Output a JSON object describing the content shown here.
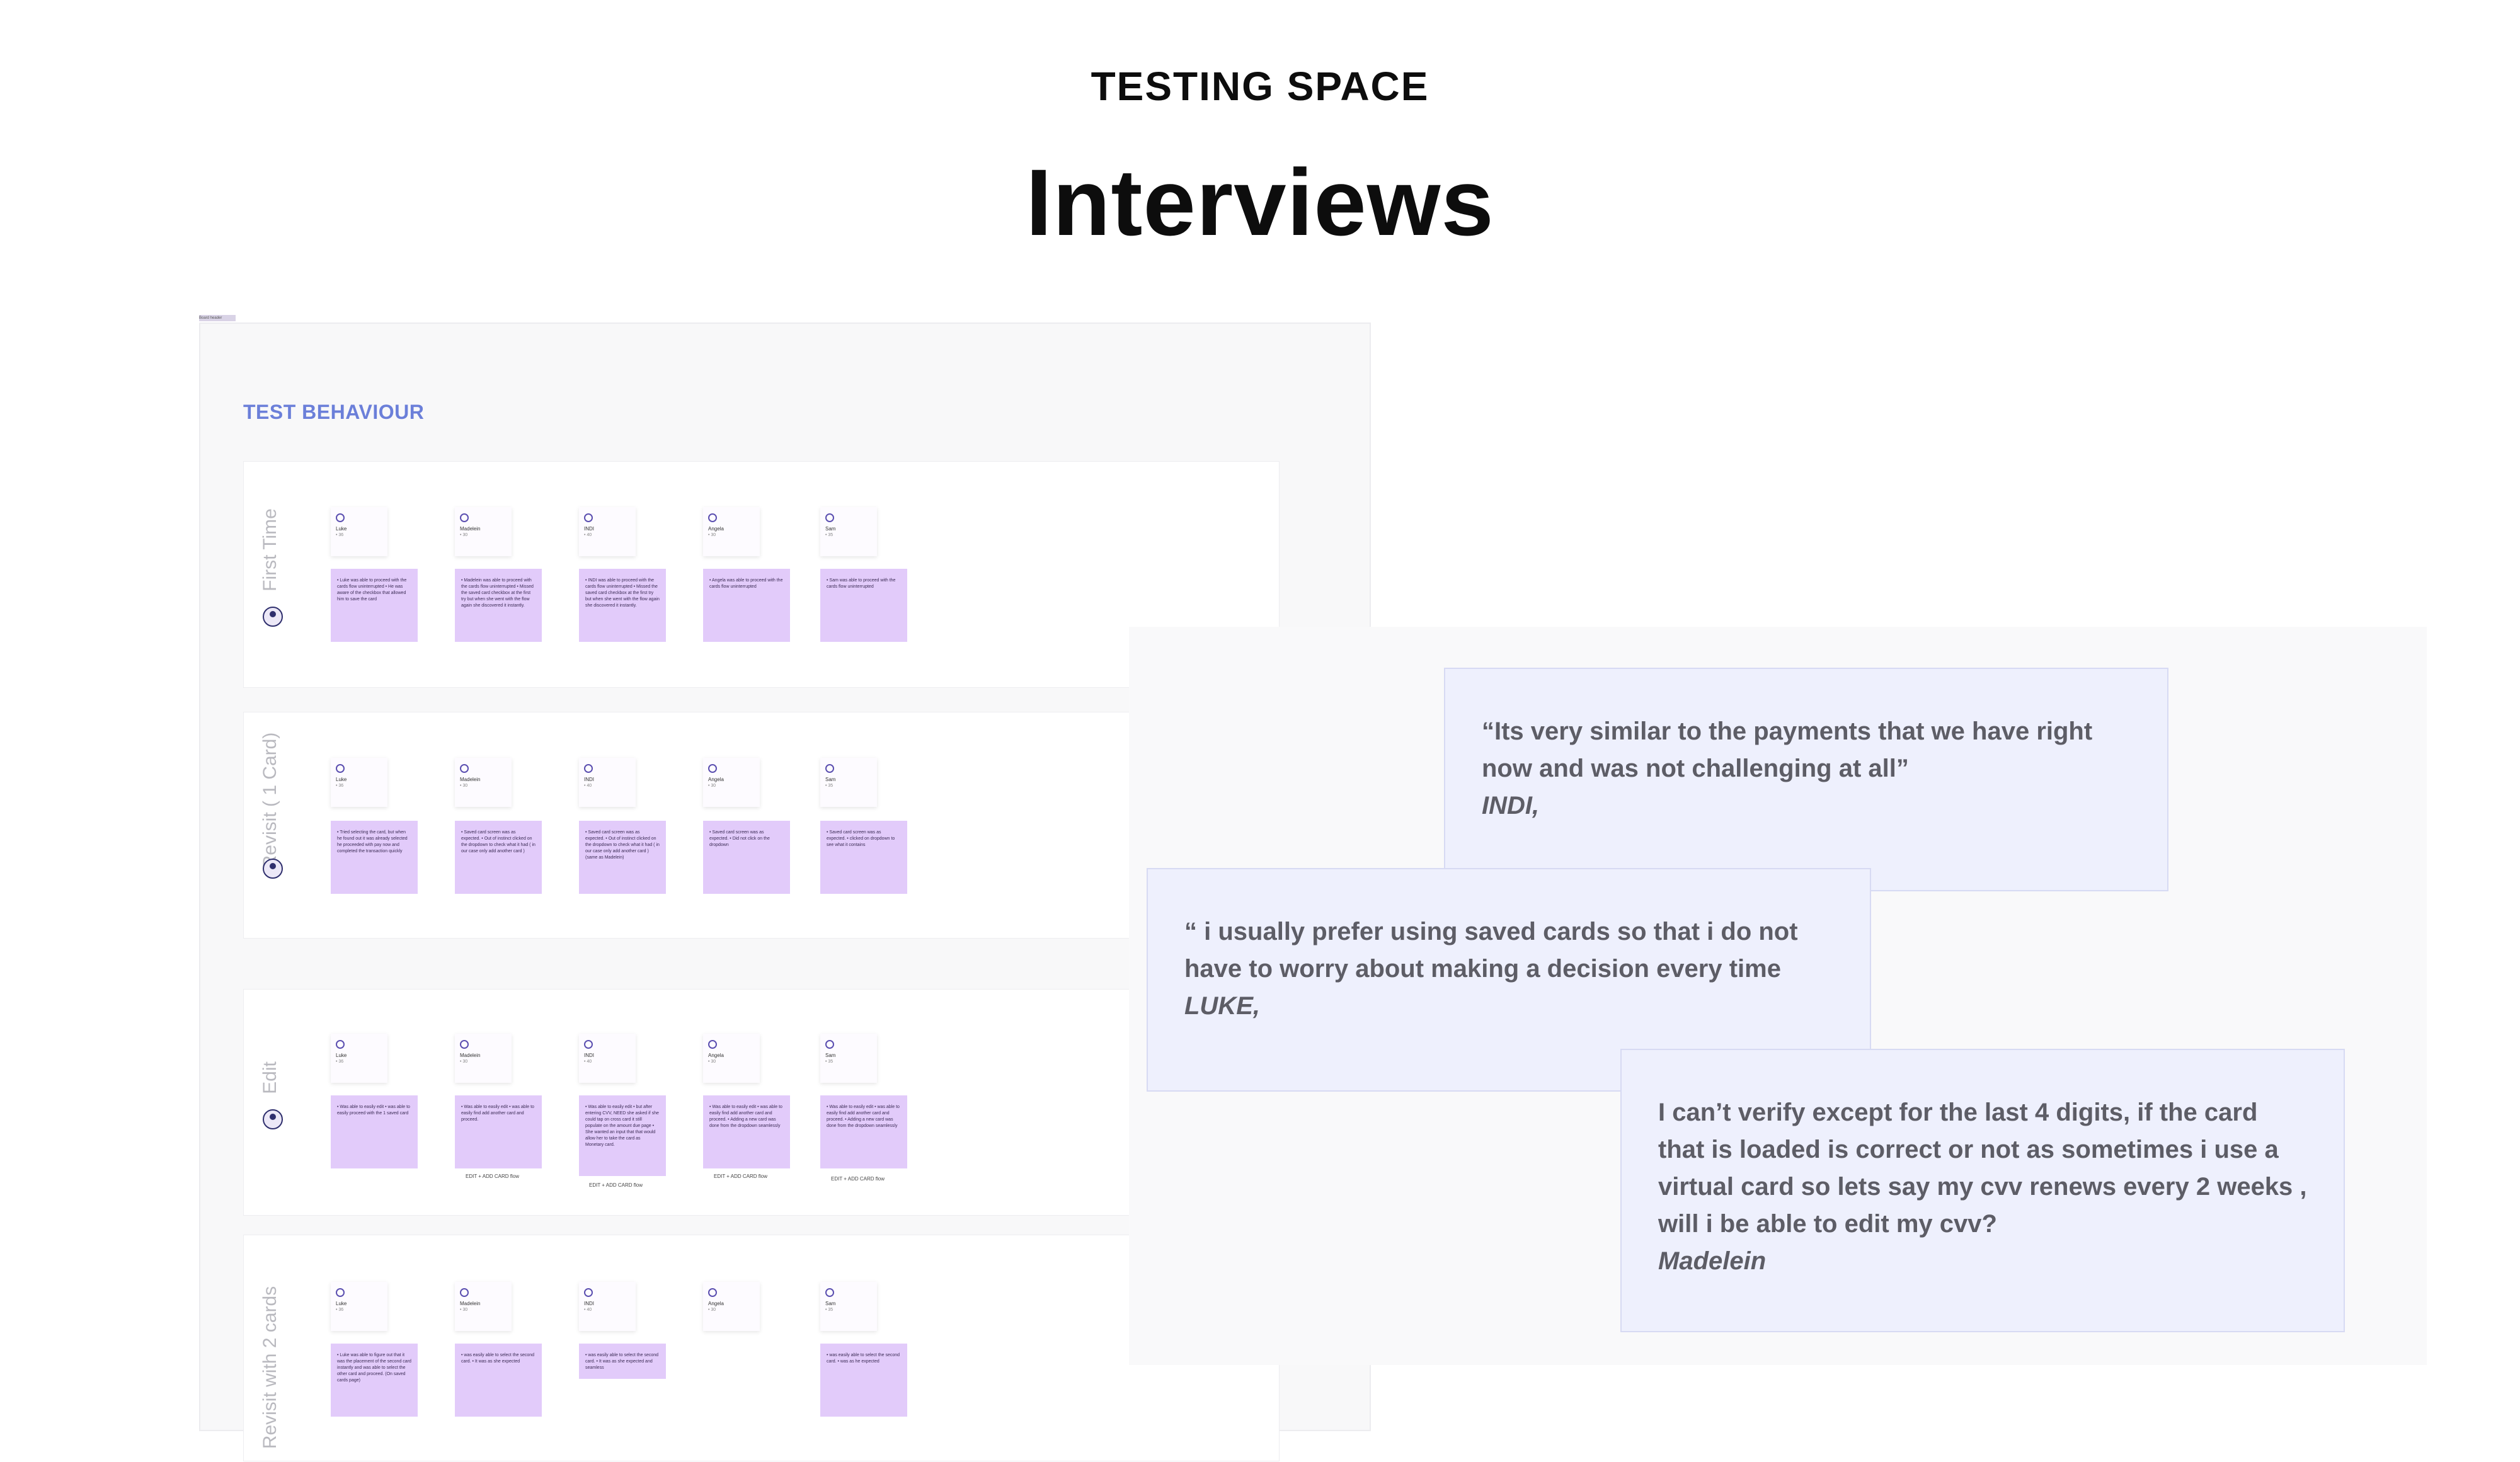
{
  "header": {
    "kicker": "TESTING SPACE",
    "title": "Interviews"
  },
  "board": {
    "tag": "Board header",
    "title": "TEST BEHAVIOUR",
    "participants": [
      {
        "name": "Luke",
        "age": "• 36"
      },
      {
        "name": "Madelein",
        "age": "• 30"
      },
      {
        "name": "INDI",
        "age": "• 40"
      },
      {
        "name": "Angela",
        "age": "• 30"
      },
      {
        "name": "Sam",
        "age": "• 35"
      }
    ],
    "rows": [
      {
        "label": "First Time",
        "notes": [
          "• Luke was able to proceed with the cards flow uninterrupted • He was aware of the checkbox that allowed him to save the card",
          "• Madelein was able to proceed with the cards flow uninterrupted • Missed the saved card checkbox at the first try but when she went with the flow again she discovered it instantly.",
          "• INDI was able to proceed with the cards flow uninterrupted • Missed the saved card checkbox at the first try but when she went with the flow again she discovered it instantly.",
          "• Angela was able to proceed with the cards flow uninterrupted",
          "• Sam was able to proceed with the cards flow uninterrupted"
        ],
        "flows": [
          "",
          "",
          "",
          "",
          ""
        ]
      },
      {
        "label": "Revisit ( 1 Card)",
        "notes": [
          "• Tried selecting the card, but when he found out it was already selected he proceeded with pay now and completed the transaction quickly",
          "• Saved card screen was as expected. • Out of instinct clicked on the dropdown to check what it had ( in our case only add another card )",
          "• Saved card screen was as expected. • Out of instinct clicked on the dropdown to check what it had ( in our case only add another card ) (same as Madelein)",
          "• Saved card screen was as expected. • Did not click on the dropdown",
          "• Saved card screen was as expected. • clicked on dropdown to see what it contains"
        ],
        "flows": [
          "",
          "",
          "",
          "",
          ""
        ]
      },
      {
        "label": "Edit",
        "notes": [
          "• Was able to easily edit • was able to easily proceed with the 1 saved card",
          "• Was able to easily edit • was able to easily find add another card and proceed.",
          "• Was able to easily edit • but after entering CVV, NEED she asked if she could tap on cross card it still populate on the amount due page • She wanted an input that that would allow her to take the card as Monetary card.",
          "• Was able to easily edit • was able to easily find add another card and proceed. • Adding a new card was done from the dropdown seamlessly",
          "• Was able to easily edit • was able to easily find add another card and proceed. • Adding a new card was done from the dropdown seamlessly"
        ],
        "flows": [
          "",
          "EDIT + ADD CARD flow",
          "EDIT + ADD CARD flow",
          "EDIT + ADD CARD flow",
          "EDIT + ADD CARD flow"
        ]
      },
      {
        "label": "Revisit with 2 cards",
        "notes": [
          "• Luke was able to figure out that it was the placement of the second card instantly and was able to select the other card and proceed. (On saved cards page)",
          "• was easily able to select the second card. • It was as she expected",
          "• was easily able to select the second card. • It was as she expected and seamless",
          "",
          "• was easily able to select the second card. • was as he expected"
        ],
        "flows": [
          "",
          "",
          "",
          "",
          ""
        ]
      }
    ]
  },
  "quotes": [
    {
      "text": "“Its very similar to the payments that we have right now and was not challenging at all”",
      "author": "INDI,"
    },
    {
      "text": "“ i usually prefer using saved cards so that i do not have to worry about making a decision every time",
      "author": "LUKE,"
    },
    {
      "text": "I can’t verify except for the last 4 digits, if the card that is loaded is correct or not as sometimes i use a virtual card so lets say my cvv renews every 2 weeks , will i be able to edit my cvv?",
      "author": "Madelein"
    }
  ]
}
